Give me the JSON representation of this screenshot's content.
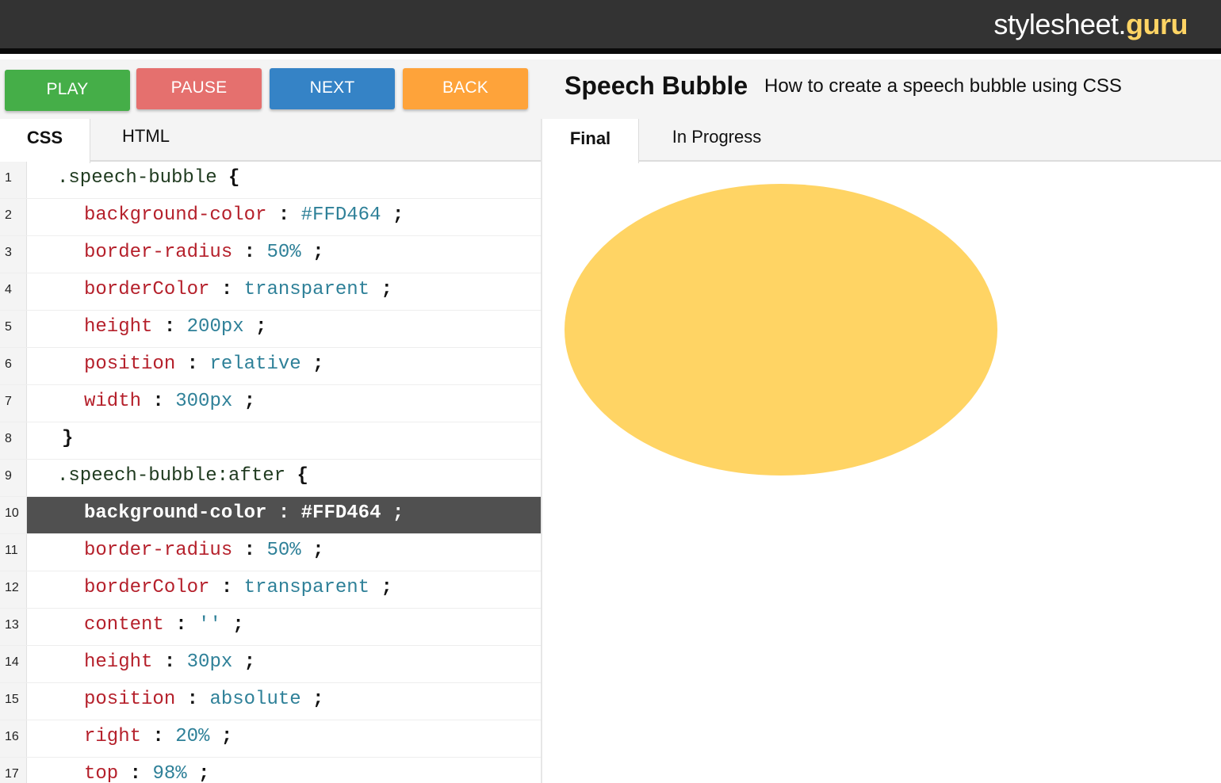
{
  "brand": {
    "name": "stylesheet.",
    "tld": "guru"
  },
  "controls": {
    "play": "PLAY",
    "pause": "PAUSE",
    "next": "NEXT",
    "back": "BACK"
  },
  "lesson": {
    "title": "Speech Bubble",
    "description": "How to create a speech bubble using CSS"
  },
  "editor_tabs": {
    "css": "CSS",
    "html": "HTML"
  },
  "preview_tabs": {
    "final": "Final",
    "in_progress": "In Progress"
  },
  "code_lines": [
    {
      "n": "1",
      "sel": ".speech-bubble",
      "open": "{"
    },
    {
      "n": "2",
      "prop": "background-color",
      "val": "#FFD464"
    },
    {
      "n": "3",
      "prop": "border-radius",
      "val": "50%"
    },
    {
      "n": "4",
      "prop": "borderColor",
      "val": "transparent"
    },
    {
      "n": "5",
      "prop": "height",
      "val": "200px"
    },
    {
      "n": "6",
      "prop": "position",
      "val": "relative"
    },
    {
      "n": "7",
      "prop": "width",
      "val": "300px"
    },
    {
      "n": "8",
      "close": "}"
    },
    {
      "n": "9",
      "sel": ".speech-bubble:after",
      "open": "{"
    },
    {
      "n": "10",
      "prop": "background-color",
      "val": "#FFD464",
      "active": true
    },
    {
      "n": "11",
      "prop": "border-radius",
      "val": "50%"
    },
    {
      "n": "12",
      "prop": "borderColor",
      "val": "transparent"
    },
    {
      "n": "13",
      "prop": "content",
      "val": "''"
    },
    {
      "n": "14",
      "prop": "height",
      "val": "30px"
    },
    {
      "n": "15",
      "prop": "position",
      "val": "absolute"
    },
    {
      "n": "16",
      "prop": "right",
      "val": "20%"
    },
    {
      "n": "17",
      "prop": "top",
      "val": "98%"
    }
  ],
  "colors": {
    "bubble": "#FFD464",
    "play": "#45AE48",
    "pause": "#E5706E",
    "next": "#3583C6",
    "back": "#FEA33A",
    "topbar": "#333333"
  }
}
